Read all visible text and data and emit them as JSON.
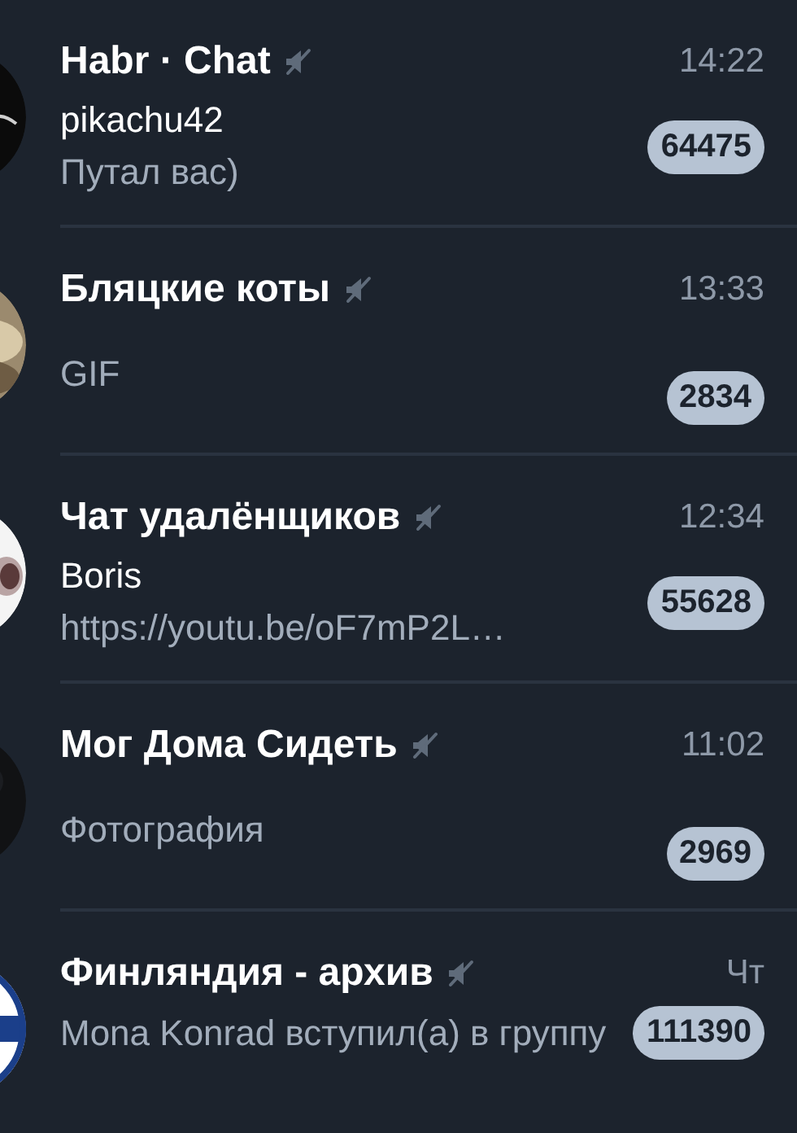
{
  "chats": [
    {
      "name": "Habr · Chat",
      "muted": true,
      "time": "14:22",
      "sender": "pikachu42",
      "preview": "Путал вас)",
      "unread": "64475"
    },
    {
      "name": "Бляцкие коты",
      "muted": true,
      "time": "13:33",
      "preview": "GIF",
      "unread": "2834"
    },
    {
      "name": "Чат удалёнщиков",
      "muted": true,
      "time": "12:34",
      "sender": "Boris",
      "preview": "https://youtu.be/oF7mP2L…",
      "unread": "55628"
    },
    {
      "name": "Мог Дома Сидеть",
      "muted": true,
      "time": "11:02",
      "preview": "Фотография",
      "unread": "2969"
    },
    {
      "name": "Финляндия - архив",
      "muted": true,
      "time": "Чт",
      "preview": "Mona Konrad вступил(а) в группу",
      "unread": "111390"
    }
  ]
}
